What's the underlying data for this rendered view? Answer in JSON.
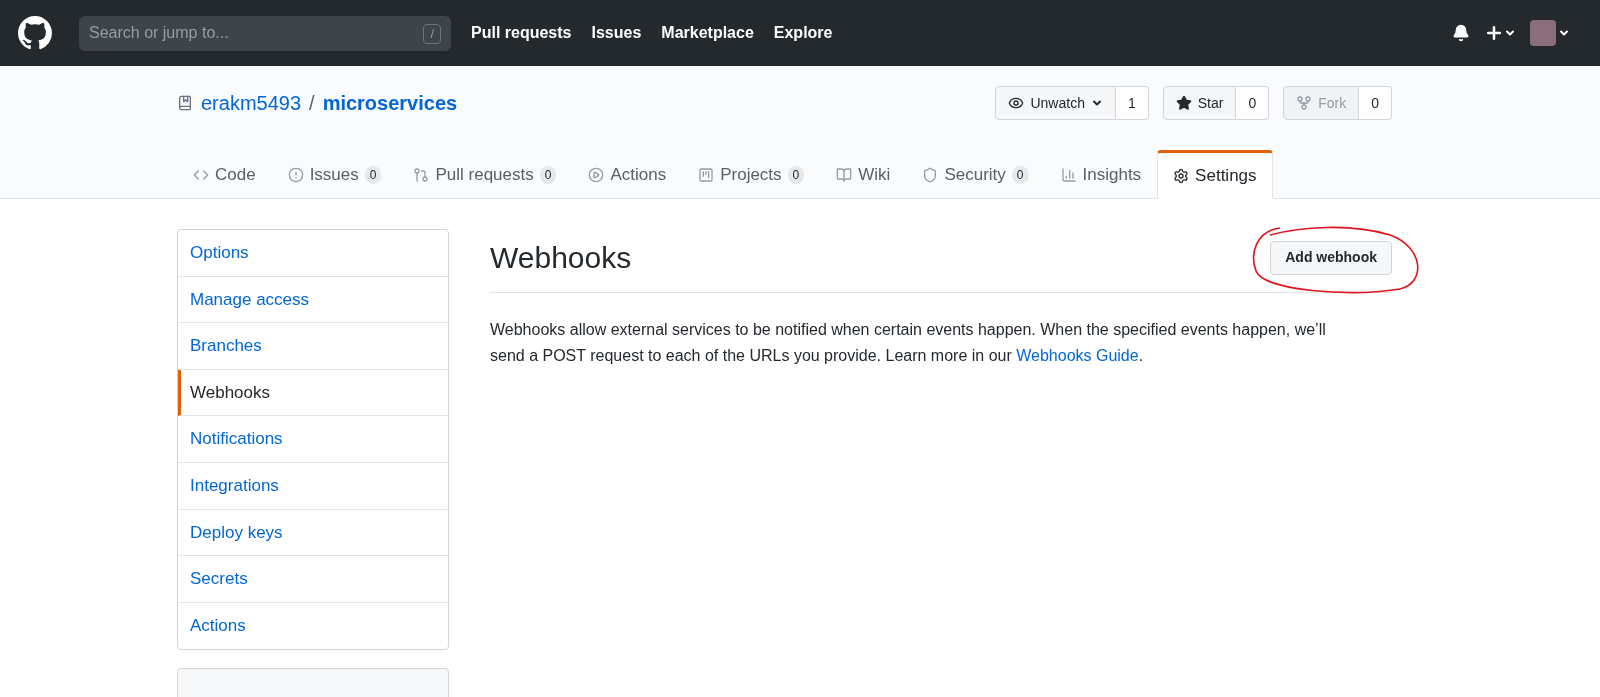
{
  "header": {
    "search": {
      "placeholder": "Search or jump to...",
      "shortcut": "/"
    },
    "nav": [
      "Pull requests",
      "Issues",
      "Marketplace",
      "Explore"
    ]
  },
  "repo": {
    "owner": "erakm5493",
    "separator": "/",
    "name": "microservices",
    "actions": [
      {
        "kind": "watch",
        "label": "Unwatch",
        "count": "1",
        "disabled": false
      },
      {
        "kind": "star",
        "label": "Star",
        "count": "0",
        "disabled": false
      },
      {
        "kind": "fork",
        "label": "Fork",
        "count": "0",
        "disabled": true
      }
    ]
  },
  "tabs": [
    {
      "kind": "code",
      "label": "Code",
      "selected": false
    },
    {
      "kind": "issues",
      "label": "Issues",
      "counter": "0",
      "selected": false
    },
    {
      "kind": "pulls",
      "label": "Pull requests",
      "counter": "0",
      "selected": false
    },
    {
      "kind": "actions",
      "label": "Actions",
      "selected": false
    },
    {
      "kind": "projects",
      "label": "Projects",
      "counter": "0",
      "selected": false
    },
    {
      "kind": "wiki",
      "label": "Wiki",
      "selected": false
    },
    {
      "kind": "security",
      "label": "Security",
      "counter": "0",
      "selected": false
    },
    {
      "kind": "insights",
      "label": "Insights",
      "selected": false
    },
    {
      "kind": "settings",
      "label": "Settings",
      "selected": true
    }
  ],
  "sidebar": {
    "items": [
      {
        "label": "Options",
        "selected": false
      },
      {
        "label": "Manage access",
        "selected": false
      },
      {
        "label": "Branches",
        "selected": false
      },
      {
        "label": "Webhooks",
        "selected": true
      },
      {
        "label": "Notifications",
        "selected": false
      },
      {
        "label": "Integrations",
        "selected": false
      },
      {
        "label": "Deploy keys",
        "selected": false
      },
      {
        "label": "Secrets",
        "selected": false
      },
      {
        "label": "Actions",
        "selected": false
      }
    ]
  },
  "main": {
    "title": "Webhooks",
    "button": "Add webhook",
    "annotated": true,
    "description": {
      "text": "Webhooks allow external services to be notified when certain events happen. When the specified events happen, we’ll send a POST request to each of the URLs you provide. Learn more in our ",
      "link": "Webhooks Guide",
      "after": "."
    }
  }
}
